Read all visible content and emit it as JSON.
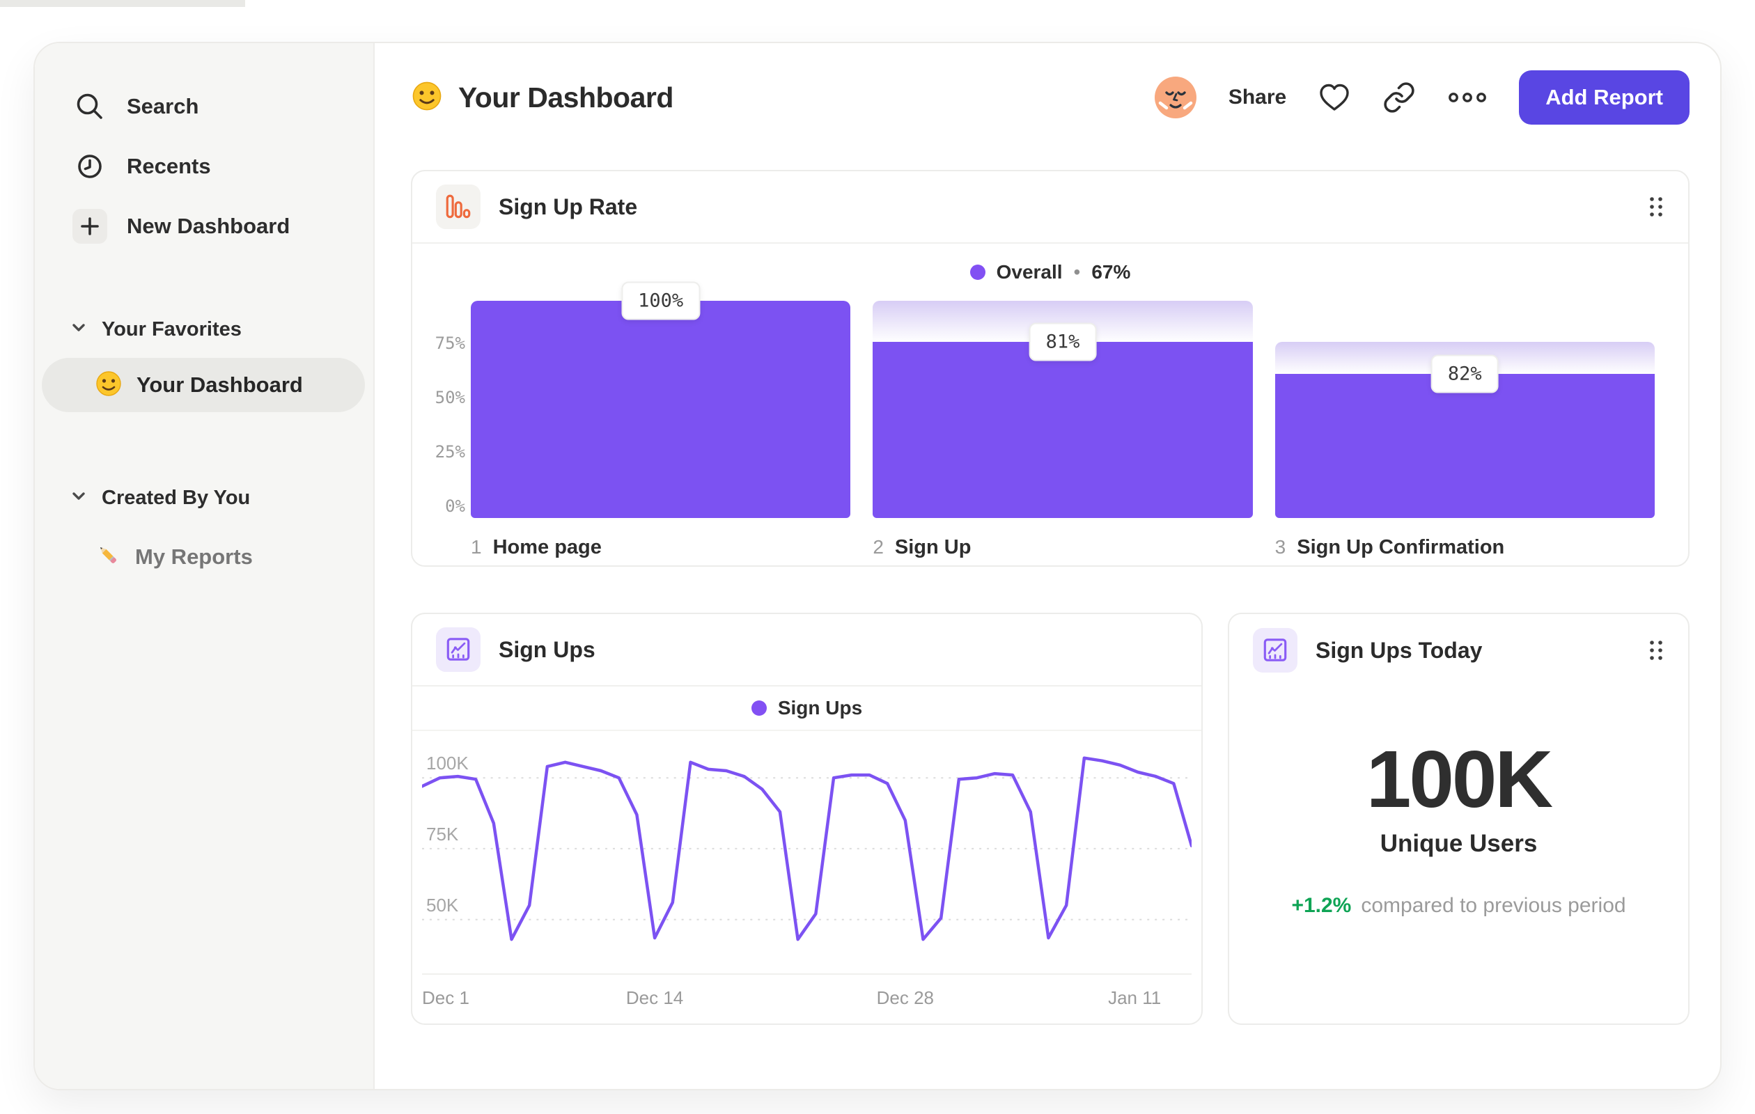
{
  "colors": {
    "accent_purple": "#7c52f2",
    "legend_purple": "#8250f3",
    "button_purple": "#5946e3",
    "icon_orange": "#ee6a3d",
    "icon_violet": "#8a5cf5",
    "delta_green": "#0fa455",
    "avatar_skin": "#f8a87e"
  },
  "sidebar": {
    "items": [
      {
        "label": "Search",
        "icon": "search-icon"
      },
      {
        "label": "Recents",
        "icon": "clock-icon"
      },
      {
        "label": "New Dashboard",
        "icon": "plus-icon"
      }
    ],
    "sections": [
      {
        "label": "Your Favorites",
        "item": {
          "emoji": "smiley-emoji",
          "label": "Your Dashboard",
          "selected": true
        }
      },
      {
        "label": "Created By You",
        "item": {
          "emoji": "pencil-emoji",
          "label": "My Reports",
          "selected": false
        }
      }
    ]
  },
  "header": {
    "emoji": "smiley-emoji",
    "title": "Your Dashboard",
    "share_label": "Share",
    "add_report_label": "Add Report"
  },
  "funnel_card": {
    "title": "Sign Up Rate",
    "legend": {
      "name": "Overall",
      "separator": "•",
      "value": "67%"
    }
  },
  "line_card": {
    "title": "Sign Ups",
    "legend": {
      "name": "Sign Ups"
    }
  },
  "stat_card": {
    "title": "Sign Ups Today",
    "value": "100K",
    "subtitle": "Unique Users",
    "delta": "+1.2%",
    "delta_caption": "compared to previous period"
  },
  "chart_data": [
    {
      "type": "bar",
      "subtype": "funnel",
      "title": "Sign Up Rate",
      "legend": "Overall • 67%",
      "overall_conversion": "67%",
      "y_ticks": [
        {
          "label": "75%",
          "value": 75
        },
        {
          "label": "50%",
          "value": 50
        },
        {
          "label": "25%",
          "value": 25
        },
        {
          "label": "0%",
          "value": 0
        }
      ],
      "ylim": [
        0,
        100
      ],
      "steps": [
        {
          "index": "1",
          "label": "Home page",
          "total_pct": 100,
          "value_pct": 100,
          "display": "100%"
        },
        {
          "index": "2",
          "label": "Sign Up",
          "total_pct": 100,
          "value_pct": 81,
          "display": "81%"
        },
        {
          "index": "3",
          "label": "Sign Up Confirmation",
          "total_pct": 81,
          "value_pct": 66.4,
          "display": "82%"
        }
      ]
    },
    {
      "type": "line",
      "title": "Sign Ups",
      "legend": "Sign Ups",
      "unit": "K",
      "ylim": [
        31,
        116.5
      ],
      "grid": "dashed-horizontal",
      "y_ticks": [
        {
          "label": "100K",
          "value": 100
        },
        {
          "label": "75K",
          "value": 75
        },
        {
          "label": "50K",
          "value": 50
        }
      ],
      "x_ticks": [
        {
          "label": "Dec 1",
          "index": 0
        },
        {
          "label": "Dec 14",
          "index": 13
        },
        {
          "label": "Dec 28",
          "index": 27
        },
        {
          "label": "Jan 11",
          "index": 41
        }
      ],
      "values": [
        97,
        100,
        100.5,
        99.5,
        84,
        43,
        55,
        104,
        105.5,
        104,
        102.5,
        100,
        87,
        43.5,
        56,
        105.5,
        103,
        102.5,
        100.5,
        96,
        88,
        43,
        52,
        100,
        101,
        101,
        98,
        85,
        43,
        50.5,
        99.5,
        100,
        101.5,
        101,
        88,
        43.5,
        55,
        107,
        106,
        104.5,
        102,
        100.5,
        98,
        76
      ]
    },
    {
      "type": "stat",
      "title": "Sign Ups Today",
      "value": "100K",
      "label": "Unique Users",
      "delta_pct": "+1.2%",
      "comparison": "compared to previous period"
    }
  ]
}
